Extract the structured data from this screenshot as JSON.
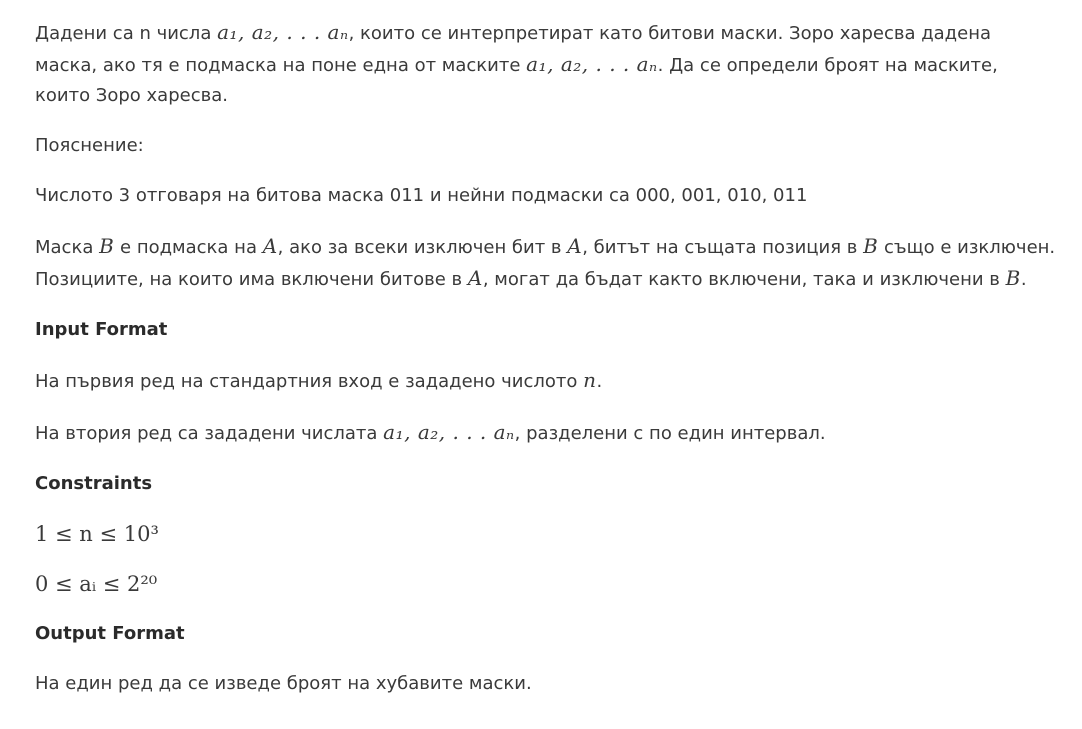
{
  "statement": {
    "p1_text_a": "Дадени са n числа ",
    "p1_math_a": "a₁, a₂, . . . aₙ",
    "p1_text_b": ", които се интерпретират като битови маски. Зоро харесва дадена маска, ако тя е подмаска на поне една от маските ",
    "p1_math_b": "a₁, a₂, . . . aₙ",
    "p1_text_c": ". Да се определи броят на маските, които Зоро харесва.",
    "explanation_label": "Пояснение:",
    "example_text": "Числото 3 отговаря на битова маска 011 и нейни подмаски са 000, 001, 010, 011",
    "p3_a": "Маска ",
    "var_B": "B",
    "p3_b": " е подмаска на ",
    "var_A": "A",
    "p3_c": ", ако за всеки изключен бит в ",
    "p3_d": ", битът на същата позиция в ",
    "p3_e": " също е изключен. Позициите, на които има включени битове в ",
    "p3_f": ", могат да бъдат както включени, така и изключени в ",
    "p3_g": "."
  },
  "input_format": {
    "heading": "Input Format",
    "line1_a": "На първия ред на стандартния вход е зададено числото ",
    "line1_var": "n",
    "line1_b": ".",
    "line2_a": "На втория ред са зададени числата ",
    "line2_math": "a₁, a₂, . . . aₙ",
    "line2_b": ", разделени с по един интервал."
  },
  "constraints": {
    "heading": "Constraints",
    "c1": "1 ≤ n ≤ 10³",
    "c2": "0 ≤ aᵢ ≤ 2²⁰"
  },
  "output_format": {
    "heading": "Output Format",
    "line": "На един ред да се изведе броят на хубавите маски."
  }
}
